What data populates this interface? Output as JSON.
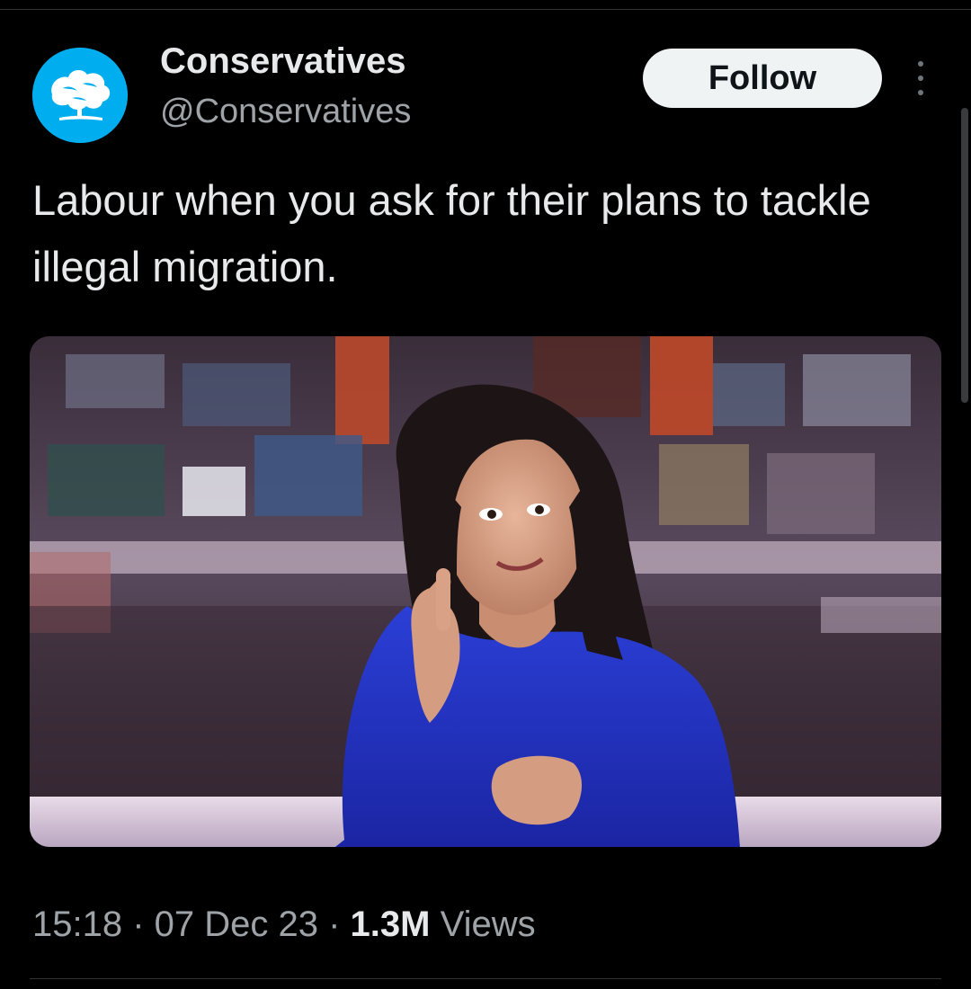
{
  "account": {
    "display_name": "Conservatives",
    "handle": "@Conservatives",
    "avatar_icon": "conservative-tree-logo-icon",
    "avatar_color": "#00aeef"
  },
  "actions": {
    "follow_label": "Follow",
    "more_icon": "more-vertical-icon"
  },
  "tweet": {
    "text": "Labour when you ask for their plans to tackle illegal migration."
  },
  "media": {
    "type": "photo"
  },
  "meta": {
    "time": "15:18",
    "separator": " · ",
    "date": "07 Dec 23",
    "views_count": "1.3M",
    "views_label": "Views"
  },
  "colors": {
    "background": "#000000",
    "text_primary": "#e7e9ea",
    "text_secondary": "#9ea3a8",
    "divider": "#2f3336",
    "follow_button_bg": "#eff3f4"
  }
}
